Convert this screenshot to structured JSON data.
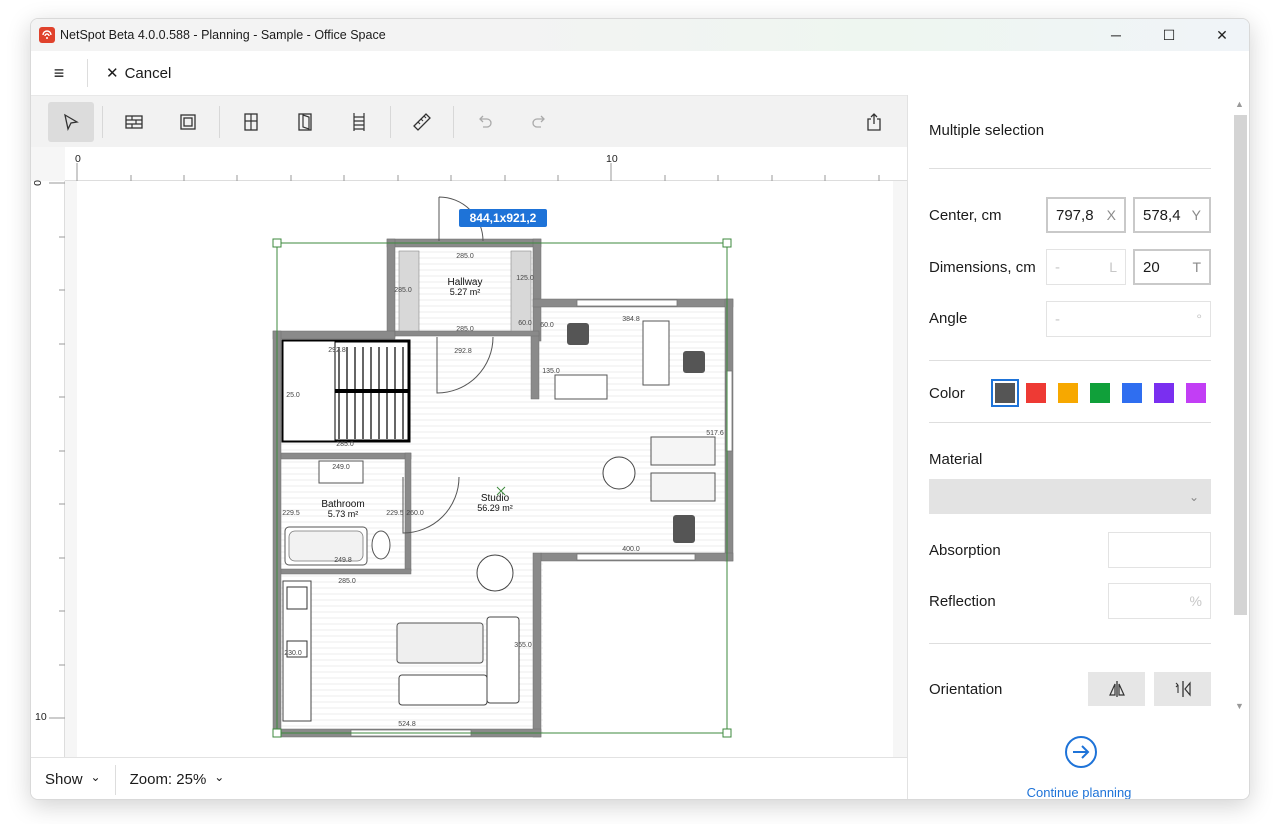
{
  "window": {
    "title": "NetSpot Beta 4.0.0.588 - Planning - Sample - Office Space",
    "minimize": "─",
    "maximize": "☐",
    "close": "✕"
  },
  "menubar": {
    "menu_glyph": "≡",
    "cancel_glyph": "✕",
    "cancel_label": "Cancel"
  },
  "toolbar": {
    "tools": [
      "select-icon",
      "wall-icon",
      "room-icon",
      "door-icon",
      "door-alt-icon",
      "window-icon",
      "ruler-icon",
      "undo-icon",
      "redo-icon",
      "export-icon"
    ]
  },
  "rulers": {
    "top_labels": [
      "0",
      "10"
    ],
    "left_labels": [
      "0",
      "10"
    ]
  },
  "floorplan": {
    "selection_size": "844,1x921,2",
    "rooms": [
      {
        "name": "Hallway",
        "area": "5.27 m²"
      },
      {
        "name": "Bathroom",
        "area": "5.73 m²"
      },
      {
        "name": "Studio",
        "area": "56.29 m²"
      }
    ],
    "dimensions": [
      "285.0",
      "285.0",
      "125.0",
      "60.0",
      "285.0",
      "60.0",
      "384.8",
      "292.8",
      "292.8",
      "135.0",
      "25.0",
      "285.0",
      "517.6",
      "249.0",
      "229.5",
      "229.5",
      "260.0",
      "249.8",
      "285.0",
      "400.0",
      "230.0",
      "365.0",
      "524.8"
    ]
  },
  "statusbar": {
    "show_label": "Show",
    "zoom_label": "Zoom: 25%",
    "chevron": "⌄"
  },
  "panel": {
    "title": "Multiple selection",
    "center_label": "Center, cm",
    "center_x": "797,8",
    "center_x_suffix": "X",
    "center_y": "578,4",
    "center_y_suffix": "Y",
    "dimensions_label": "Dimensions, cm",
    "dim_l": "-",
    "dim_l_suffix": "L",
    "dim_t": "20",
    "dim_t_suffix": "T",
    "angle_label": "Angle",
    "angle_value": "-",
    "angle_suffix": "°",
    "color_label": "Color",
    "colors": [
      "#555555",
      "#ee3a34",
      "#f7a800",
      "#10a03a",
      "#2f6ef0",
      "#7a2ff0",
      "#c23ef5"
    ],
    "material_label": "Material",
    "material_value": "",
    "absorption_label": "Absorption",
    "absorption_value": "",
    "reflection_label": "Reflection",
    "reflection_suffix": "%",
    "orientation_label": "Orientation",
    "continue_label": "Continue planning"
  }
}
